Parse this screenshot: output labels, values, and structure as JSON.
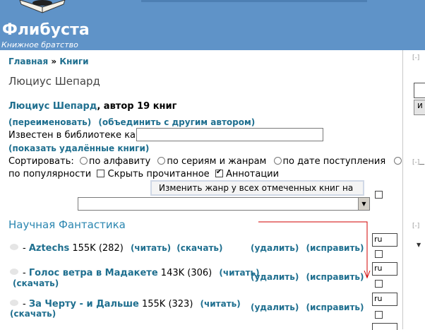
{
  "site": {
    "name": "Флибуста",
    "subtitle": "Книжное братство"
  },
  "breadcrumb": {
    "home": "Главная",
    "separator": "»",
    "books": "Книги"
  },
  "page_title": "Люциус Шепард",
  "author": {
    "name": "Люциус Шепард",
    "summary": ", автор 19 книг",
    "rename_link": "(переименовать)",
    "merge_link": "(объединить с другим автором)",
    "known_as_label": "Известен в библиотеке как",
    "known_as_value": "",
    "show_deleted_link": "(показать удалённые книги)"
  },
  "sort": {
    "label": "Сортировать:",
    "options": [
      "по алфавиту",
      "по сериям и жанрам",
      "по дате поступления",
      "по популярности"
    ],
    "hide_read_label": "Скрыть прочитанное",
    "hide_read_checked": false,
    "annotations_label": "Аннотации",
    "annotations_checked": true
  },
  "genre_change_button": "Изменить жанр у всех отмеченных книг на",
  "genre_select_value": "",
  "section": "Научная Фантастика",
  "books": [
    {
      "title": "Aztechs",
      "size": "155K",
      "pages": "(282)",
      "read": "(читать)",
      "download": "(скачать)",
      "delete": "(удалить)",
      "edit": "(исправить)",
      "lang": "ru"
    },
    {
      "title": "Голос ветра в Мадакете",
      "size": "143K",
      "pages": "(306)",
      "read": "(читать)",
      "download": "(скачать)",
      "delete": "(удалить)",
      "edit": "(исправить)",
      "lang": "ru"
    },
    {
      "title": "За Черту - и Дальше",
      "size": "155K",
      "pages": "(323)",
      "read": "(читать)",
      "download": "(скачать)",
      "delete": "(удалить)",
      "edit": "(исправить)",
      "lang": "ru"
    }
  ],
  "book_prefix": "-",
  "sidebar": {
    "collapse": "[-]",
    "button_label": "и"
  },
  "colors": {
    "header_bg": "#5f93c8",
    "link": "#1f6f8f",
    "section_title": "#2a86b0",
    "annotation_line": "#d00000"
  },
  "icons": {
    "logo": "open-book-logo",
    "book": "book-bullet-icon",
    "dropdown": "chevron-down-icon"
  }
}
